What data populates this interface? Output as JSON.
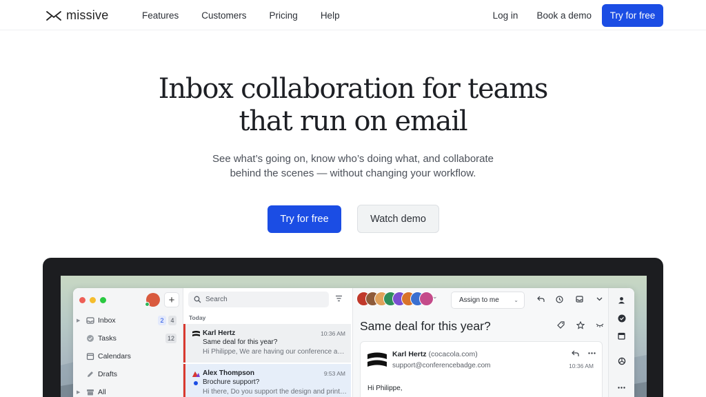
{
  "brand": {
    "name": "missive"
  },
  "nav": {
    "links": [
      "Features",
      "Customers",
      "Pricing",
      "Help"
    ],
    "login": "Log in",
    "book_demo": "Book a demo",
    "try_free": "Try for free"
  },
  "hero": {
    "title_line1": "Inbox collaboration for teams",
    "title_line2": "that run on email",
    "subtitle_line1": "See what’s going on, know who’s doing what, and collaborate",
    "subtitle_line2": "behind the scenes — without changing your workflow.",
    "cta_primary": "Try for free",
    "cta_secondary": "Watch demo"
  },
  "app": {
    "sidebar": {
      "items": [
        {
          "label": "Inbox",
          "badges": [
            "2",
            "4"
          ]
        },
        {
          "label": "Tasks",
          "badges": [
            "12"
          ]
        },
        {
          "label": "Calendars",
          "badges": []
        },
        {
          "label": "Drafts",
          "badges": []
        },
        {
          "label": "All",
          "badges": []
        }
      ]
    },
    "list": {
      "search_placeholder": "Search",
      "section": "Today",
      "messages": [
        {
          "from": "Karl Hertz",
          "time": "10:36 AM",
          "subject": "Same deal for this year?",
          "preview": "Hi Philippe, We are having our conference again this year"
        },
        {
          "from": "Alex Thompson",
          "time": "9:53 AM",
          "subject": "Brochure support?",
          "preview": "Hi there, Do you support the design and printing of brochures"
        }
      ]
    },
    "detail": {
      "assign_label": "Assign to me",
      "subject": "Same deal for this year?",
      "sender_name": "Karl Hertz",
      "sender_domain": "(cocacola.com)",
      "to": "support@conferencebadge.com",
      "time": "10:36 AM",
      "greeting": "Hi Philippe,"
    },
    "colors": {
      "accent": "#1b4de4",
      "unread_bar": "#d9392f",
      "avatars": [
        "#c0392b",
        "#8e5b3a",
        "#e0a15a",
        "#2f8f5b",
        "#7a4fd0",
        "#d9732b",
        "#3a6fd0",
        "#c44b8a"
      ]
    }
  }
}
